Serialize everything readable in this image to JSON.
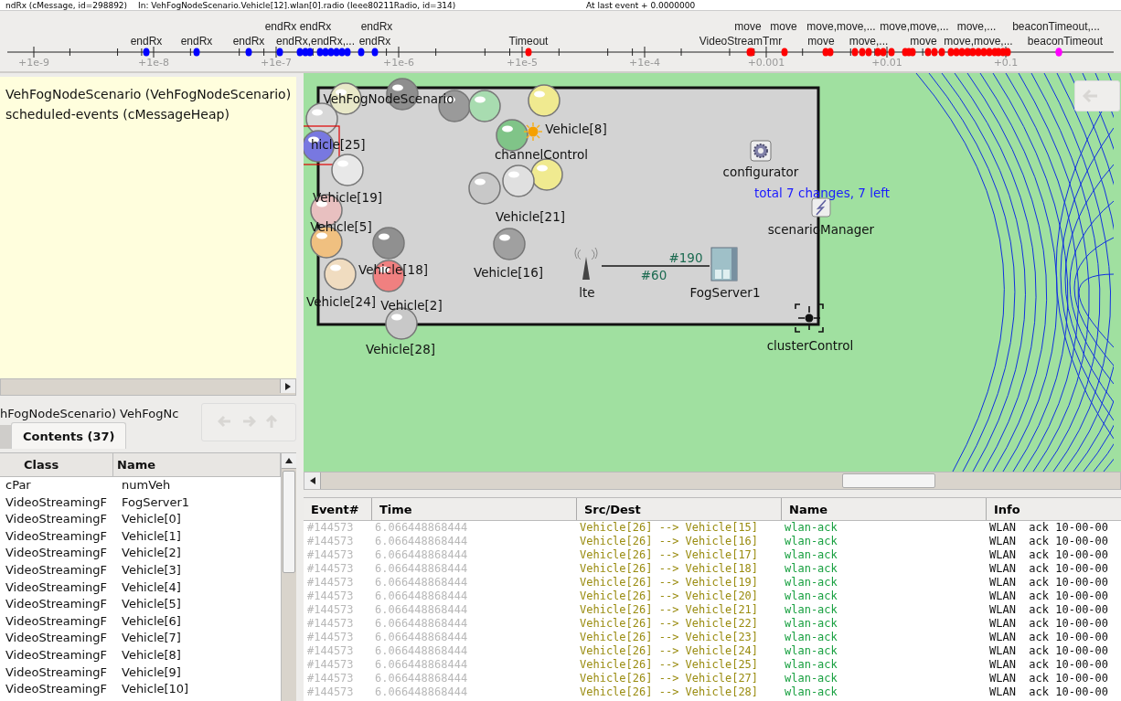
{
  "title_strip": [
    "ndRx (cMessage, id=298892)",
    "In: VehFogNodeScenario.Vehicle[12].wlan[0].radio (Ieee80211Radio, id=314)",
    "At last event + 0.0000000"
  ],
  "timeline": {
    "ticks": [
      "+1e-9",
      "+1e-8",
      "+1e-7",
      "+1e-6",
      "+1e-5",
      "+1e-4",
      "+0.001",
      "+0.01",
      "+0.1"
    ],
    "events": [
      {
        "label": "endRx",
        "color": "#0000ff"
      },
      {
        "label": "endRx",
        "color": "#0000ff"
      },
      {
        "label": "endRx",
        "color": "#0000ff"
      },
      {
        "label": "move",
        "color": "#ff0000"
      },
      {
        "label": "move",
        "color": "#ff0000"
      },
      {
        "label": "move,move,...",
        "color": "#ff0000"
      },
      {
        "label": "move,move,...",
        "color": "#ff0000"
      },
      {
        "label": "move,...",
        "color": "#ff0000"
      },
      {
        "label": "beaconTimeout,...",
        "color": "#ff00ff"
      },
      {
        "label": "endRx",
        "color": "#0000ff"
      },
      {
        "label": "endRx",
        "color": "#0000ff"
      },
      {
        "label": "endRx",
        "color": "#0000ff"
      },
      {
        "label": "endRx,endRx,...",
        "color": "#0000ff"
      },
      {
        "label": "endRx",
        "color": "#0000ff"
      },
      {
        "label": "Timeout",
        "color": "#ff0000"
      },
      {
        "label": "VideoStreamTmr",
        "color": "#ff0000"
      },
      {
        "label": "move",
        "color": "#ff0000"
      },
      {
        "label": "move,...",
        "color": "#ff0000"
      },
      {
        "label": "move",
        "color": "#ff0000"
      },
      {
        "label": "move,move,...",
        "color": "#ff0000"
      },
      {
        "label": "beaconTimeout",
        "color": "#ff00ff"
      }
    ]
  },
  "object_tree": {
    "items": [
      "VehFogNodeScenario (VehFogNodeScenario)",
      "scheduled-events (cMessageHeap)"
    ]
  },
  "inspector": {
    "breadcrumb": "hFogNodeScenario) VehFogNc",
    "tabs": [
      {
        "label": "Contents (37)",
        "selected": true
      }
    ],
    "columns": [
      "Class",
      "Name"
    ],
    "rows": [
      [
        "cPar",
        "numVeh"
      ],
      [
        "VideoStreamingF",
        "FogServer1"
      ],
      [
        "VideoStreamingF",
        "Vehicle[0]"
      ],
      [
        "VideoStreamingF",
        "Vehicle[1]"
      ],
      [
        "VideoStreamingF",
        "Vehicle[2]"
      ],
      [
        "VideoStreamingF",
        "Vehicle[3]"
      ],
      [
        "VideoStreamingF",
        "Vehicle[4]"
      ],
      [
        "VideoStreamingF",
        "Vehicle[5]"
      ],
      [
        "VideoStreamingF",
        "Vehicle[6]"
      ],
      [
        "VideoStreamingF",
        "Vehicle[7]"
      ],
      [
        "VideoStreamingF",
        "Vehicle[8]"
      ],
      [
        "VideoStreamingF",
        "Vehicle[9]"
      ],
      [
        "VideoStreamingF",
        "Vehicle[10]"
      ]
    ]
  },
  "network": {
    "module_name": "VehFogNodeScenario",
    "status_text": "total 7 changes, 7 left",
    "link_labels": [
      "#60",
      "#190"
    ],
    "nodes": [
      {
        "kind": "vehicle",
        "color": "#d8d8d8",
        "selected": false
      },
      {
        "kind": "vehicle",
        "color": "#e8e8c8",
        "selected": false
      },
      {
        "kind": "vehicle",
        "color": "#8e8e8e",
        "selected": false
      },
      {
        "kind": "vehicle",
        "color": "#9a9a9a",
        "selected": false
      },
      {
        "kind": "vehicle",
        "color": "#a8dcb0",
        "selected": false
      },
      {
        "kind": "vehicle",
        "color": "#80c488",
        "selected": false
      },
      {
        "kind": "vehicle",
        "label": "Vehicle[8]",
        "color": "#f0ea90",
        "selected": false
      },
      {
        "kind": "channel-control",
        "label": "channelControl",
        "selected": false
      },
      {
        "kind": "vehicle",
        "color": "#f0ea90",
        "selected": false
      },
      {
        "kind": "vehicle",
        "color": "#c8c8c8",
        "selected": false
      },
      {
        "kind": "vehicle",
        "label": "Vehicle[21]",
        "color": "#e0e0e0",
        "selected": false
      },
      {
        "kind": "vehicle",
        "label": "hicle[25]",
        "color": "#7878e0",
        "selected": true
      },
      {
        "kind": "vehicle",
        "label": "Vehicle[19]",
        "color": "#e8e8e8",
        "selected": false
      },
      {
        "kind": "vehicle",
        "label": "Vehicle[5]",
        "color": "#e8c0c0",
        "selected": false
      },
      {
        "kind": "vehicle",
        "color": "#f0c080",
        "selected": false
      },
      {
        "kind": "vehicle",
        "label": "Vehicle[18]",
        "color": "#909090",
        "selected": false
      },
      {
        "kind": "vehicle",
        "label": "Vehicle[2]",
        "color": "#f08080",
        "selected": false
      },
      {
        "kind": "vehicle",
        "label": "Vehicle[24]",
        "color": "#f0dcc0",
        "selected": false
      },
      {
        "kind": "vehicle",
        "label": "Vehicle[28]",
        "color": "#c8c8c8",
        "selected": false
      },
      {
        "kind": "vehicle",
        "label": "Vehicle[16]",
        "color": "#a0a0a0",
        "selected": false
      },
      {
        "kind": "configurator",
        "label": "configurator",
        "selected": false
      },
      {
        "kind": "scenario-manager",
        "label": "scenarioManager",
        "selected": false
      },
      {
        "kind": "antenna",
        "label": "lte",
        "selected": false
      },
      {
        "kind": "server",
        "label": "FogServer1",
        "selected": false
      },
      {
        "kind": "cluster-control",
        "label": "clusterControl",
        "selected": false
      }
    ]
  },
  "event_log": {
    "columns": [
      "Event#",
      "Time",
      "Src/Dest",
      "Name",
      "Info"
    ],
    "rows": [
      [
        "#144573",
        "6.066448868444",
        "Vehicle[26] --> Vehicle[15]",
        "wlan-ack",
        "WLAN  ack 10-00-00"
      ],
      [
        "#144573",
        "6.066448868444",
        "Vehicle[26] --> Vehicle[16]",
        "wlan-ack",
        "WLAN  ack 10-00-00"
      ],
      [
        "#144573",
        "6.066448868444",
        "Vehicle[26] --> Vehicle[17]",
        "wlan-ack",
        "WLAN  ack 10-00-00"
      ],
      [
        "#144573",
        "6.066448868444",
        "Vehicle[26] --> Vehicle[18]",
        "wlan-ack",
        "WLAN  ack 10-00-00"
      ],
      [
        "#144573",
        "6.066448868444",
        "Vehicle[26] --> Vehicle[19]",
        "wlan-ack",
        "WLAN  ack 10-00-00"
      ],
      [
        "#144573",
        "6.066448868444",
        "Vehicle[26] --> Vehicle[20]",
        "wlan-ack",
        "WLAN  ack 10-00-00"
      ],
      [
        "#144573",
        "6.066448868444",
        "Vehicle[26] --> Vehicle[21]",
        "wlan-ack",
        "WLAN  ack 10-00-00"
      ],
      [
        "#144573",
        "6.066448868444",
        "Vehicle[26] --> Vehicle[22]",
        "wlan-ack",
        "WLAN  ack 10-00-00"
      ],
      [
        "#144573",
        "6.066448868444",
        "Vehicle[26] --> Vehicle[23]",
        "wlan-ack",
        "WLAN  ack 10-00-00"
      ],
      [
        "#144573",
        "6.066448868444",
        "Vehicle[26] --> Vehicle[24]",
        "wlan-ack",
        "WLAN  ack 10-00-00"
      ],
      [
        "#144573",
        "6.066448868444",
        "Vehicle[26] --> Vehicle[25]",
        "wlan-ack",
        "WLAN  ack 10-00-00"
      ],
      [
        "#144573",
        "6.066448868444",
        "Vehicle[26] --> Vehicle[27]",
        "wlan-ack",
        "WLAN  ack 10-00-00"
      ],
      [
        "#144573",
        "6.066448868444",
        "Vehicle[26] --> Vehicle[28]",
        "wlan-ack",
        "WLAN  ack 10-00-00"
      ]
    ]
  }
}
